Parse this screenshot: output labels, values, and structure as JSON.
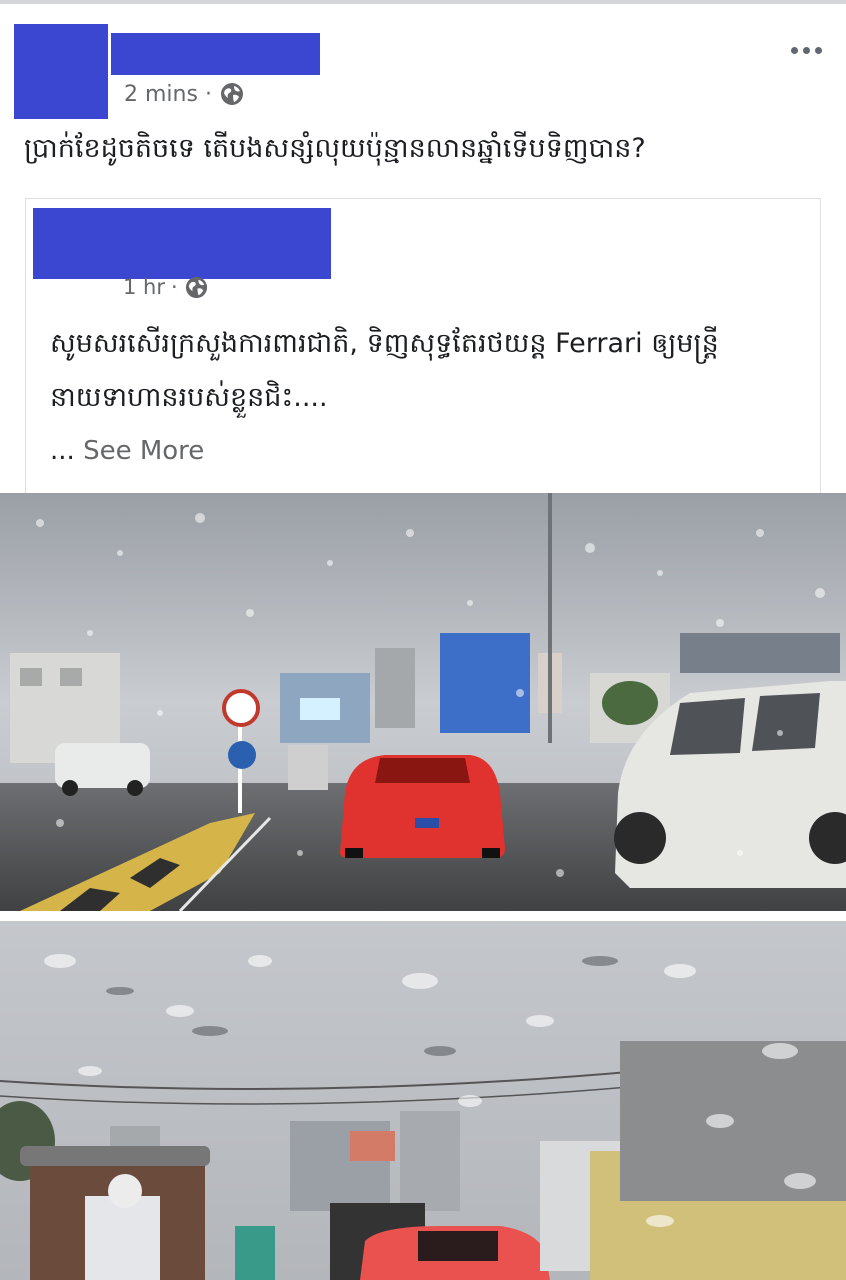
{
  "post": {
    "timestamp": "2 mins",
    "separator": "·",
    "audience_icon": "globe-icon",
    "more_icon": "more-options-icon",
    "text": "ប្រាក់ខែដូចតិចទេ តើបងសន្សំលុយប៉ុន្មានលានឆ្នាំទើបទិញបាន?"
  },
  "shared_post": {
    "timestamp": "1 hr",
    "separator": "·",
    "audience_icon": "globe-icon",
    "text_line1": "សូមសរសើរក្រសួងការពារជាតិ, ទិញសុទ្ធតែរថយន្ត Ferrari ឲ្យមន្ត្រី",
    "text_line2": "នាយទាហានរបស់ខ្លួនជិះ....",
    "ellipsis": "...",
    "see_more": "See More"
  },
  "photos": [
    {
      "description_icon": "photo-ferrari-rainy-road"
    },
    {
      "description_icon": "photo-ferrari-traffic-rear"
    }
  ],
  "colors": {
    "redaction": "#3b46d1",
    "secondary_text": "#65676b",
    "primary_text": "#1c1e21"
  }
}
